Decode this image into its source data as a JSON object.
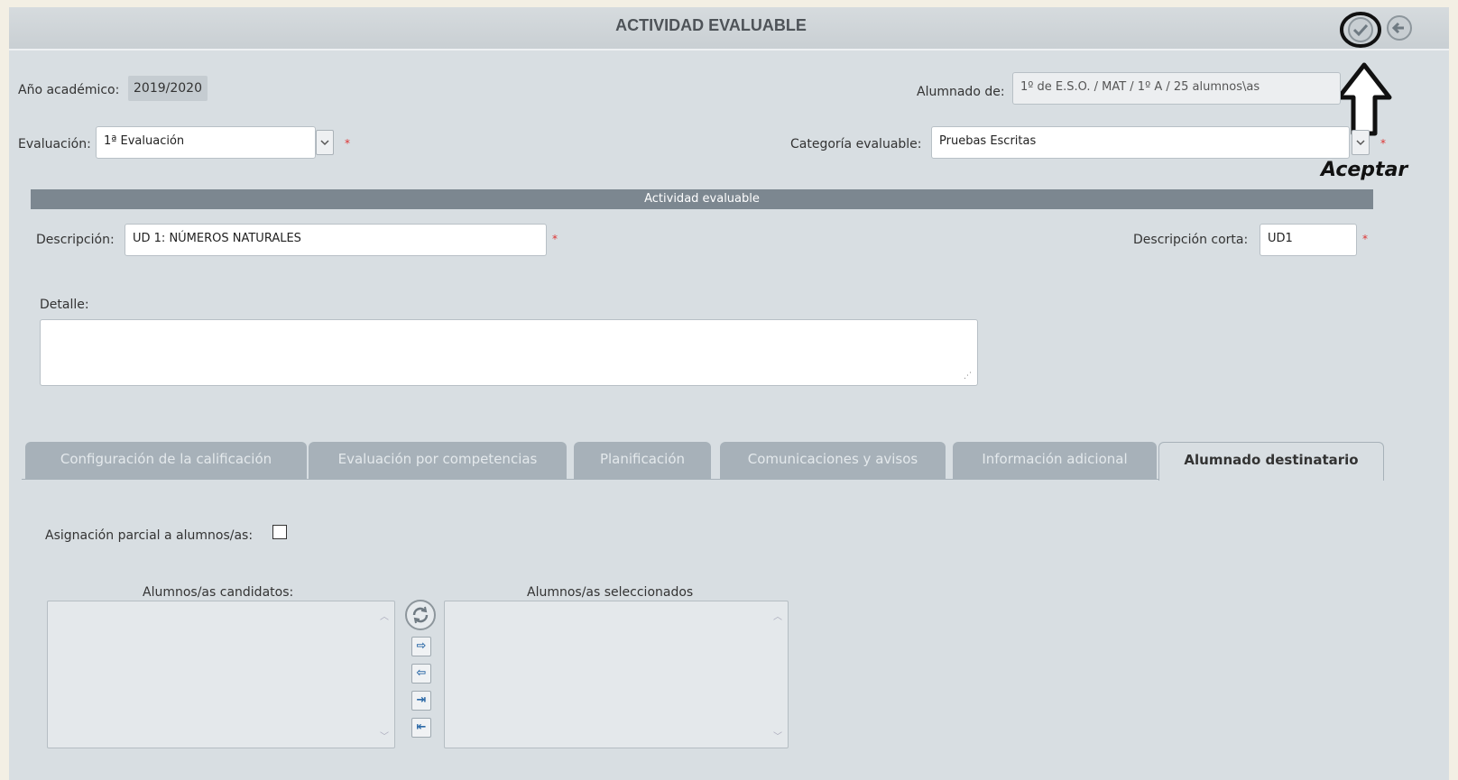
{
  "header": {
    "title": "ACTIVIDAD EVALUABLE"
  },
  "annotation": {
    "label": "Aceptar"
  },
  "form": {
    "year_label": "Año académico:",
    "year_value": "2019/2020",
    "students_label": "Alumnado de:",
    "students_value": "1º de E.S.O. / MAT / 1º A / 25 alumnos\\as",
    "evaluation_label": "Evaluación:",
    "evaluation_value": "1ª Evaluación",
    "category_label": "Categoría evaluable:",
    "category_value": "Pruebas Escritas",
    "required_mark": "*"
  },
  "section": {
    "title": "Actividad evaluable",
    "description_label": "Descripción:",
    "description_value": "UD 1: NÚMEROS NATURALES",
    "short_label": "Descripción corta:",
    "short_value": "UD1",
    "detail_label": "Detalle:",
    "detail_value": ""
  },
  "tabs": [
    {
      "label": "Configuración de la calificación"
    },
    {
      "label": "Evaluación por competencias"
    },
    {
      "label": "Planificación"
    },
    {
      "label": "Comunicaciones y avisos"
    },
    {
      "label": "Información adicional"
    },
    {
      "label": "Alumnado destinatario"
    }
  ],
  "assignment": {
    "partial_label": "Asignación parcial a alumnos/as:",
    "candidates_label": "Alumnos/as candidatos:",
    "selected_label": "Alumnos/as seleccionados"
  },
  "icons": {
    "accept": "check-circle-icon",
    "back": "back-arrow-icon",
    "refresh": "refresh-icon",
    "arrow_up_annotation": "up-arrow-icon"
  }
}
